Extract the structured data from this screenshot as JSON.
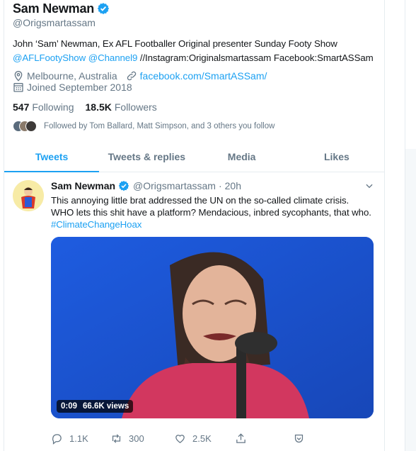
{
  "profile": {
    "name": "Sam Newman",
    "handle": "@Origsmartassam",
    "bio_prefix": "John ‘Sam’ Newman, Ex AFL Footballer Original presenter Sunday Footy Show",
    "bio_link1": "@AFLFootyShow",
    "bio_link2": "@Channel9",
    "bio_suffix": "//Instagram:Originalsmartassam Facebook:SmartASSam",
    "location": "Melbourne, Australia",
    "website": "facebook.com/SmartASSam/",
    "joined": "Joined September 2018",
    "following_count": "547",
    "following_label": "Following",
    "followers_count": "18.5K",
    "followers_label": "Followers",
    "followed_by": "Followed by Tom Ballard, Matt Simpson, and 3 others you follow"
  },
  "tabs": [
    "Tweets",
    "Tweets & replies",
    "Media",
    "Likes"
  ],
  "tweet": {
    "author": "Sam Newman",
    "handle": "@Origsmartassam",
    "sep": "·",
    "time": "20h",
    "text": "This annoying little brat addressed the UN on the so-called climate crisis. WHO lets this shit have a platform? Mendacious, inbred sycophants, that who.",
    "hashtag": "#ClimateChangeHoax",
    "video_time": "0:09",
    "video_views": "66.6K views",
    "replies": "1.1K",
    "retweets": "300",
    "likes": "2.5K"
  },
  "colors": {
    "accent": "#1da1f2",
    "muted": "#657786",
    "text": "#14171a"
  },
  "icons": [
    "verified-badge-icon",
    "location-pin-icon",
    "link-icon",
    "calendar-icon",
    "chevron-down-icon",
    "reply-icon",
    "retweet-icon",
    "like-icon",
    "share-icon",
    "tweet-analytics-icon"
  ]
}
